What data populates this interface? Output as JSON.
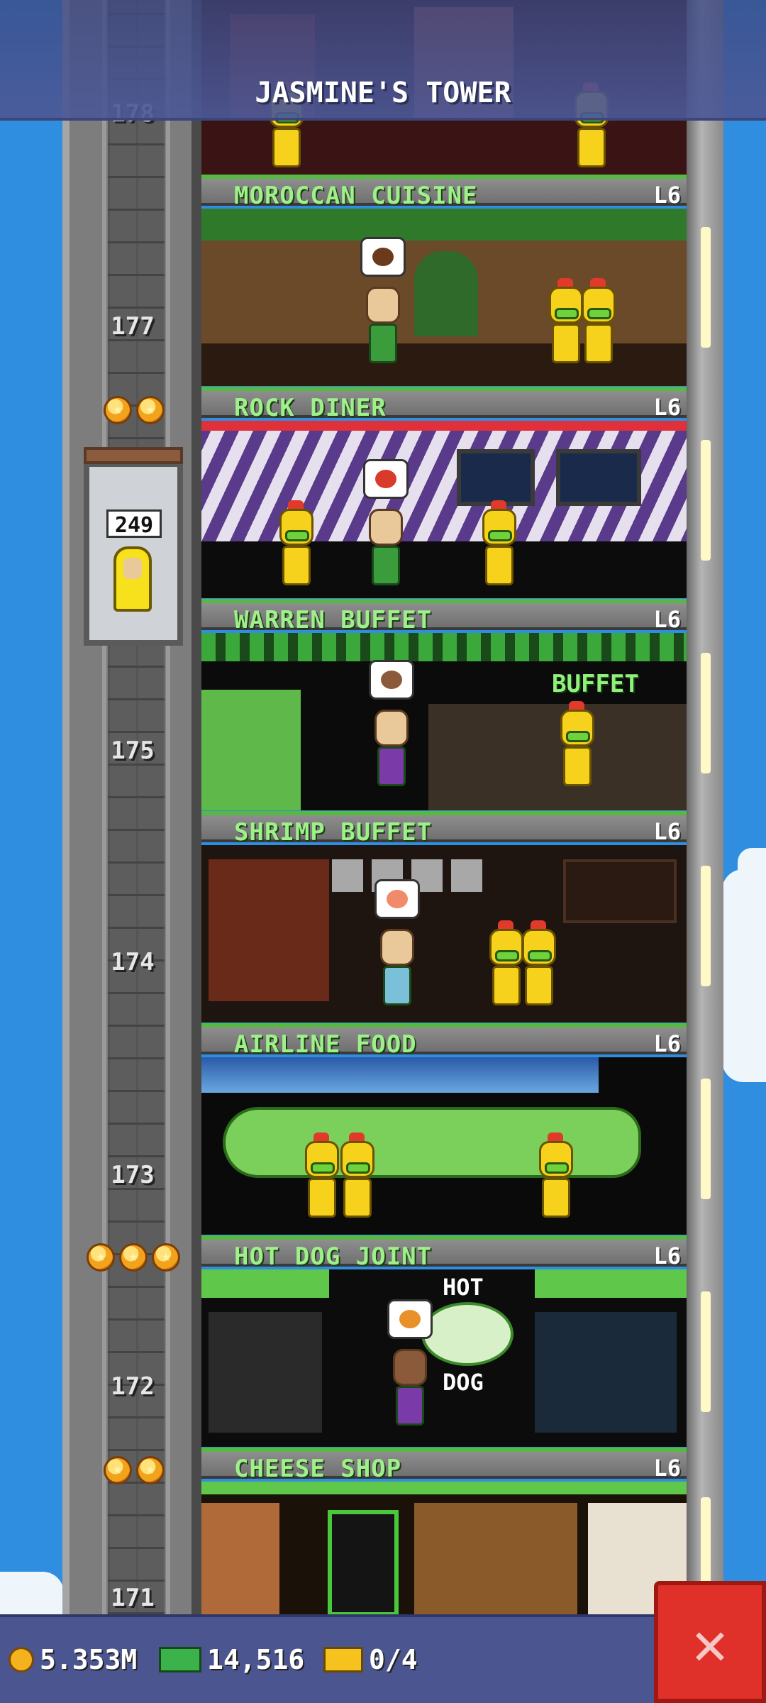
{
  "header": {
    "title": "JASMINE'S TOWER"
  },
  "elevator": {
    "display": "249"
  },
  "shaft_floor_numbers": {
    "f178": "178",
    "f177": "177",
    "f175": "175",
    "f174": "174",
    "f173": "173",
    "f172": "172",
    "f171": "171"
  },
  "floors": [
    {
      "name": "MOROCCAN CUISINE",
      "level": "L6"
    },
    {
      "name": "ROCK DINER",
      "level": "L6"
    },
    {
      "name": "WARREN BUFFET",
      "level": "L6"
    },
    {
      "name": "SHRIMP BUFFET",
      "level": "L6"
    },
    {
      "name": "AIRLINE FOOD",
      "level": "L6"
    },
    {
      "name": "HOT DOG JOINT",
      "level": "L6"
    },
    {
      "name": "CHEESE SHOP",
      "level": "L6"
    }
  ],
  "signs": {
    "buffet": "BUFFET",
    "hot": "HOT",
    "dog": "DOG"
  },
  "status_bar": {
    "coins": "5.353M",
    "bux": "14,516",
    "tickets": "0/4"
  },
  "colors": {
    "sky": "#2f8ee0",
    "floor_label_text": "#9ff08a",
    "close_button": "#e0302a",
    "status_bar": "#4b5590"
  },
  "icons": {
    "coin": "coin-icon",
    "bux": "bux-icon",
    "ticket": "golden-ticket-icon",
    "close": "close-icon"
  }
}
